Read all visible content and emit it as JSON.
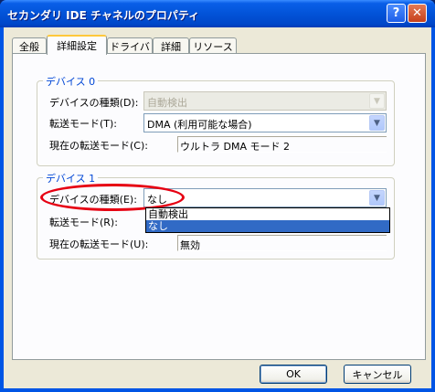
{
  "window": {
    "title": "セカンダリ IDE チャネルのプロパティ",
    "help_glyph": "?",
    "close_glyph": "✕"
  },
  "tabs": [
    {
      "label": "全般",
      "active": false
    },
    {
      "label": "詳細設定",
      "active": true
    },
    {
      "label": "ドライバ",
      "active": false
    },
    {
      "label": "詳細",
      "active": false
    },
    {
      "label": "リソース",
      "active": false
    }
  ],
  "device0": {
    "legend": "デバイス 0",
    "type_label": "デバイスの種類(D):",
    "type_value": "自動検出",
    "mode_label": "転送モード(T):",
    "mode_value": "DMA (利用可能な場合)",
    "current_label": "現在の転送モード(C):",
    "current_value": "ウルトラ DMA モード 2"
  },
  "device1": {
    "legend": "デバイス 1",
    "type_label": "デバイスの種類(E):",
    "type_value": "なし",
    "mode_label": "転送モード(R):",
    "current_label": "現在の転送モード(U):",
    "current_value": "無効",
    "dropdown_options": [
      "自動検出",
      "なし"
    ],
    "dropdown_selected": "なし"
  },
  "buttons": {
    "ok": "OK",
    "cancel": "キャンセル"
  },
  "colors": {
    "highlight": "#316ac5",
    "annotation": "#e60012",
    "legend": "#0046d5"
  }
}
